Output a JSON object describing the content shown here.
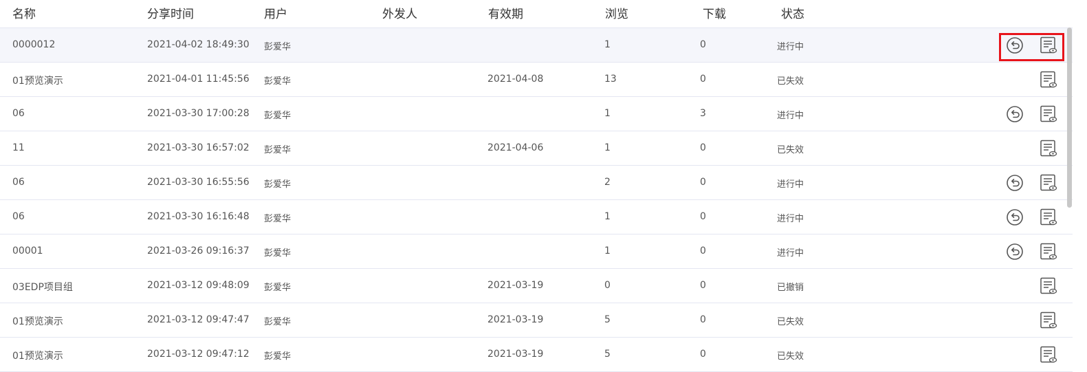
{
  "columns": {
    "name": "名称",
    "time": "分享时间",
    "user": "用户",
    "sender": "外发人",
    "expiry": "有效期",
    "views": "浏览",
    "downloads": "下载",
    "status": "状态"
  },
  "rows": [
    {
      "name": "0000012",
      "time": "2021-04-02 18:49:30",
      "user": "彭爱华",
      "sender": "",
      "expiry": "",
      "views": "1",
      "downloads": "0",
      "status": "进行中",
      "revocable": true
    },
    {
      "name": "01预览演示",
      "time": "2021-04-01 11:45:56",
      "user": "彭爱华",
      "sender": "",
      "expiry": "2021-04-08",
      "views": "13",
      "downloads": "0",
      "status": "已失效",
      "revocable": false
    },
    {
      "name": "06",
      "time": "2021-03-30 17:00:28",
      "user": "彭爱华",
      "sender": "",
      "expiry": "",
      "views": "1",
      "downloads": "3",
      "status": "进行中",
      "revocable": true
    },
    {
      "name": "11",
      "time": "2021-03-30 16:57:02",
      "user": "彭爱华",
      "sender": "",
      "expiry": "2021-04-06",
      "views": "1",
      "downloads": "0",
      "status": "已失效",
      "revocable": false
    },
    {
      "name": "06",
      "time": "2021-03-30 16:55:56",
      "user": "彭爱华",
      "sender": "",
      "expiry": "",
      "views": "2",
      "downloads": "0",
      "status": "进行中",
      "revocable": true
    },
    {
      "name": "06",
      "time": "2021-03-30 16:16:48",
      "user": "彭爱华",
      "sender": "",
      "expiry": "",
      "views": "1",
      "downloads": "0",
      "status": "进行中",
      "revocable": true
    },
    {
      "name": "00001",
      "time": "2021-03-26 09:16:37",
      "user": "彭爱华",
      "sender": "",
      "expiry": "",
      "views": "1",
      "downloads": "0",
      "status": "进行中",
      "revocable": true
    },
    {
      "name": "03EDP项目组",
      "time": "2021-03-12 09:48:09",
      "user": "彭爱华",
      "sender": "",
      "expiry": "2021-03-19",
      "views": "0",
      "downloads": "0",
      "status": "已撤销",
      "revocable": false
    },
    {
      "name": "01预览演示",
      "time": "2021-03-12 09:47:47",
      "user": "彭爱华",
      "sender": "",
      "expiry": "2021-03-19",
      "views": "5",
      "downloads": "0",
      "status": "已失效",
      "revocable": false
    },
    {
      "name": "01预览演示",
      "time": "2021-03-12 09:47:12",
      "user": "彭爱华",
      "sender": "",
      "expiry": "2021-03-19",
      "views": "5",
      "downloads": "0",
      "status": "已失效",
      "revocable": false
    }
  ],
  "icons": {
    "revoke": "revoke-icon",
    "detail": "view-detail-icon"
  },
  "colors": {
    "highlight_border": "#e8141b",
    "selected_row": "#f5f6fb",
    "row_divider": "#e4e6f2",
    "icon": "#555555"
  }
}
